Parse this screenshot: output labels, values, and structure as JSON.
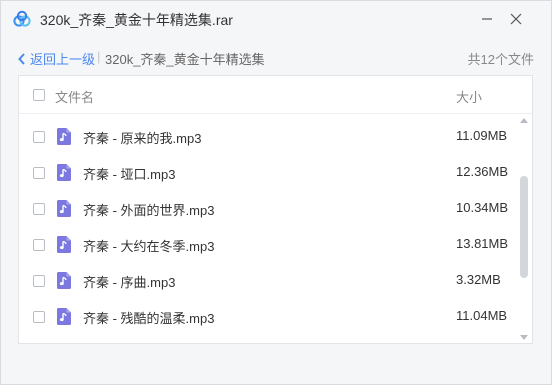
{
  "window": {
    "title": "320k_齐秦_黄金十年精选集.rar",
    "min_icon": "minimize-icon",
    "close_icon": "close-icon"
  },
  "nav": {
    "back_label": "返回上一级",
    "separator": "|",
    "breadcrumb": "320k_齐秦_黄金十年精选集",
    "file_count": "共12个文件"
  },
  "table": {
    "columns": {
      "name": "文件名",
      "size": "大小"
    },
    "rows": [
      {
        "name": "齐秦 - 原来的我.mp3",
        "size": "11.09MB"
      },
      {
        "name": "齐秦 - 垭口.mp3",
        "size": "12.36MB"
      },
      {
        "name": "齐秦 - 外面的世界.mp3",
        "size": "10.34MB"
      },
      {
        "name": "齐秦 - 大约在冬季.mp3",
        "size": "13.81MB"
      },
      {
        "name": "齐秦 - 序曲.mp3",
        "size": "3.32MB"
      },
      {
        "name": "齐秦 - 残酷的温柔.mp3",
        "size": "11.04MB"
      }
    ]
  },
  "colors": {
    "accent": "#4a88f0",
    "file_icon": "#7b79e0"
  }
}
